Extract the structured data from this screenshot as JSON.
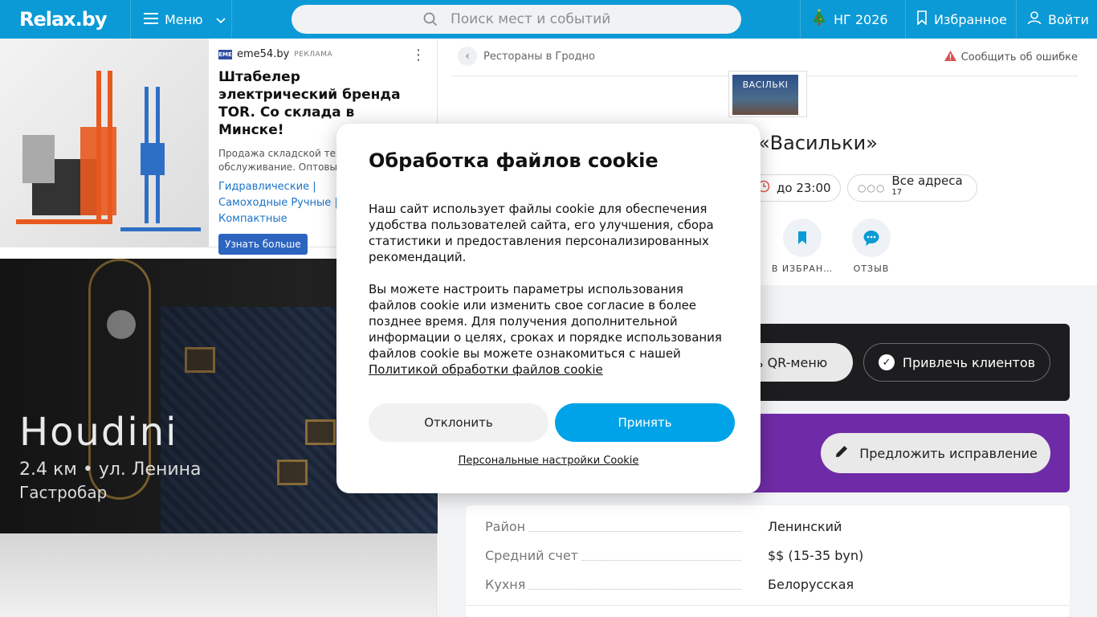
{
  "header": {
    "logo": "Relax.by",
    "menu_label": "Меню",
    "search_placeholder": "Поиск мест и событий",
    "ng_label": "НГ 2026",
    "favorites_label": "Избранное",
    "login_label": "Войти"
  },
  "ad": {
    "source": "eme54.by",
    "source_badge": "EME",
    "tag": "РЕКЛАМА",
    "title": "Штабелер электрический бренда TOR. Со склада в Минске!",
    "desc": "Продажа складской техники, обслуживание. Оптовые цены.",
    "links": "Гидравлические   |   Самоходные   Ручные   |   Компактные",
    "button": "Узнать больше"
  },
  "promo": {
    "title": "Houdini",
    "subtitle": "2.4 км • ул. Ленина",
    "type": "Гастробар"
  },
  "place": {
    "breadcrumb": "Рестораны в Гродно",
    "report": "Сообщить об ошибке",
    "logo_text": "ВАСІЛЬКІ",
    "title": "«Васильки»",
    "hours": "до 23:00",
    "addresses": "Все адреса",
    "addresses_count": "17",
    "action_fav": "В ИЗБРАН…",
    "action_review": "ОТЗЫВ",
    "qr_menu": "ть QR-меню",
    "attract": "Привлечь клиентов",
    "suggest": "Предложить исправление"
  },
  "info": [
    {
      "k": "Район",
      "v": "Ленинский"
    },
    {
      "k": "Средний счет",
      "v": "$$ (15-35 byn)"
    },
    {
      "k": "Кухня",
      "v": "Белорусская"
    }
  ],
  "cookie": {
    "title": "Обработка файлов cookie",
    "p1": "Наш сайт использует файлы cookie для обеспечения удобства пользователей сайта, его улучшения, сбора статистики и предоставления персонализированных рекомендаций.",
    "p2": "Вы можете настроить параметры использования файлов cookie или изменить свое согласие в более позднее время. Для получения дополнительной информации о целях, сроках и порядке использования файлов cookie вы можете ознакомиться с нашей",
    "policy_link": "Политикой обработки файлов cookie",
    "decline": "Отклонить",
    "accept": "Принять",
    "settings_link": "Персональные настройки Cookie"
  },
  "colors": {
    "brand": "#0b9ad6",
    "accept": "#00a3e8",
    "purple": "#6f2ba7"
  }
}
